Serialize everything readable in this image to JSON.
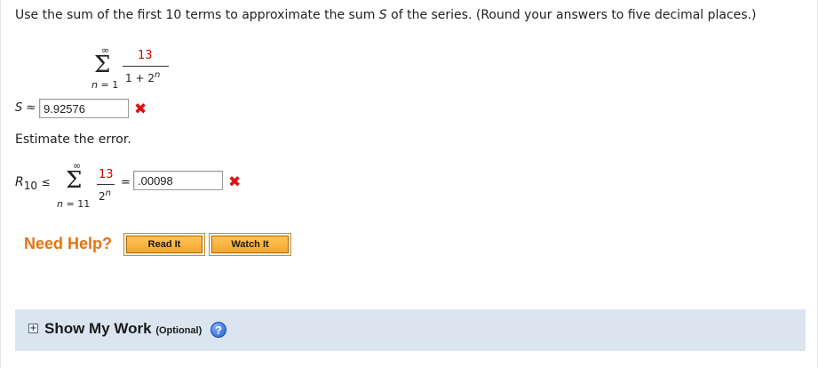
{
  "question": {
    "instruction_prefix": "Use the sum of the first 10 terms to approximate the sum ",
    "instruction_var": "S",
    "instruction_suffix": " of the series. (Round your answers to five decimal places.)"
  },
  "series1": {
    "upper": "∞",
    "sigma": "Σ",
    "lower_var": "n",
    "lower_rest": " = 1",
    "numerator": "13",
    "den_base": "1 + 2",
    "den_exp": "n"
  },
  "answer1": {
    "label_var": "S",
    "label_rel": "≈",
    "value": "9.92576",
    "status": "incorrect",
    "mark": "✖"
  },
  "error_section": {
    "heading": "Estimate the error."
  },
  "series2": {
    "lhs_var": "R",
    "lhs_sub": "10",
    "relation": "≤",
    "upper": "∞",
    "sigma": "Σ",
    "lower_var": "n",
    "lower_rest": " = 11",
    "numerator": "13",
    "den_base": "2",
    "den_exp": "n",
    "equals": "="
  },
  "answer2": {
    "value": ".00098",
    "status": "incorrect",
    "mark": "✖"
  },
  "help": {
    "label": "Need Help?",
    "read_button": "Read It",
    "watch_button": "Watch It"
  },
  "show_work": {
    "toggle_symbol": "+",
    "title": "Show My Work",
    "optional": "(Optional)",
    "help_symbol": "?"
  },
  "colors": {
    "incorrect": "#dd1111",
    "accent_orange": "#e8730c",
    "panel_bg": "#dbe5ef",
    "numerator_red": "#d00000"
  }
}
